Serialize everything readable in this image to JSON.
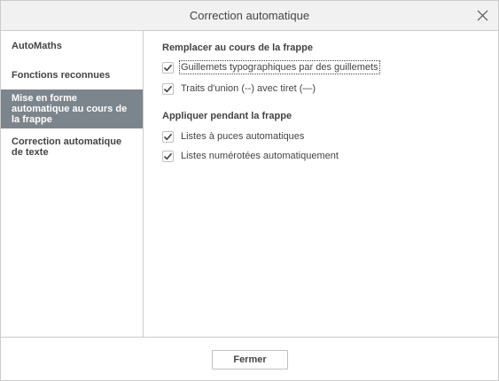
{
  "dialog": {
    "title": "Correction automatique",
    "close_icon": "close-icon"
  },
  "sidebar": {
    "items": [
      {
        "label": "AutoMaths",
        "active": false
      },
      {
        "label": "Fonctions reconnues",
        "active": false
      },
      {
        "label": "Mise en forme automatique au cours de la frappe",
        "active": true
      },
      {
        "label": "Correction automatique de texte",
        "active": false
      }
    ]
  },
  "main": {
    "replace_section": {
      "title": "Remplacer au cours de la frappe",
      "options": [
        {
          "label": "Guillemets typographiques par des guillemets",
          "checked": true
        },
        {
          "label": "Traits d'union (--) avec tiret (—)",
          "checked": true
        }
      ]
    },
    "apply_section": {
      "title": "Appliquer pendant la frappe",
      "options": [
        {
          "label": "Listes à puces automatiques",
          "checked": true
        },
        {
          "label": "Listes numérotées automatiquement",
          "checked": true
        }
      ]
    }
  },
  "footer": {
    "close_button_label": "Fermer"
  },
  "colors": {
    "active_item_bg": "#7d858c",
    "titlebar_bg": "#f1f1f1",
    "border": "#cbcbcb",
    "text": "#444444"
  }
}
